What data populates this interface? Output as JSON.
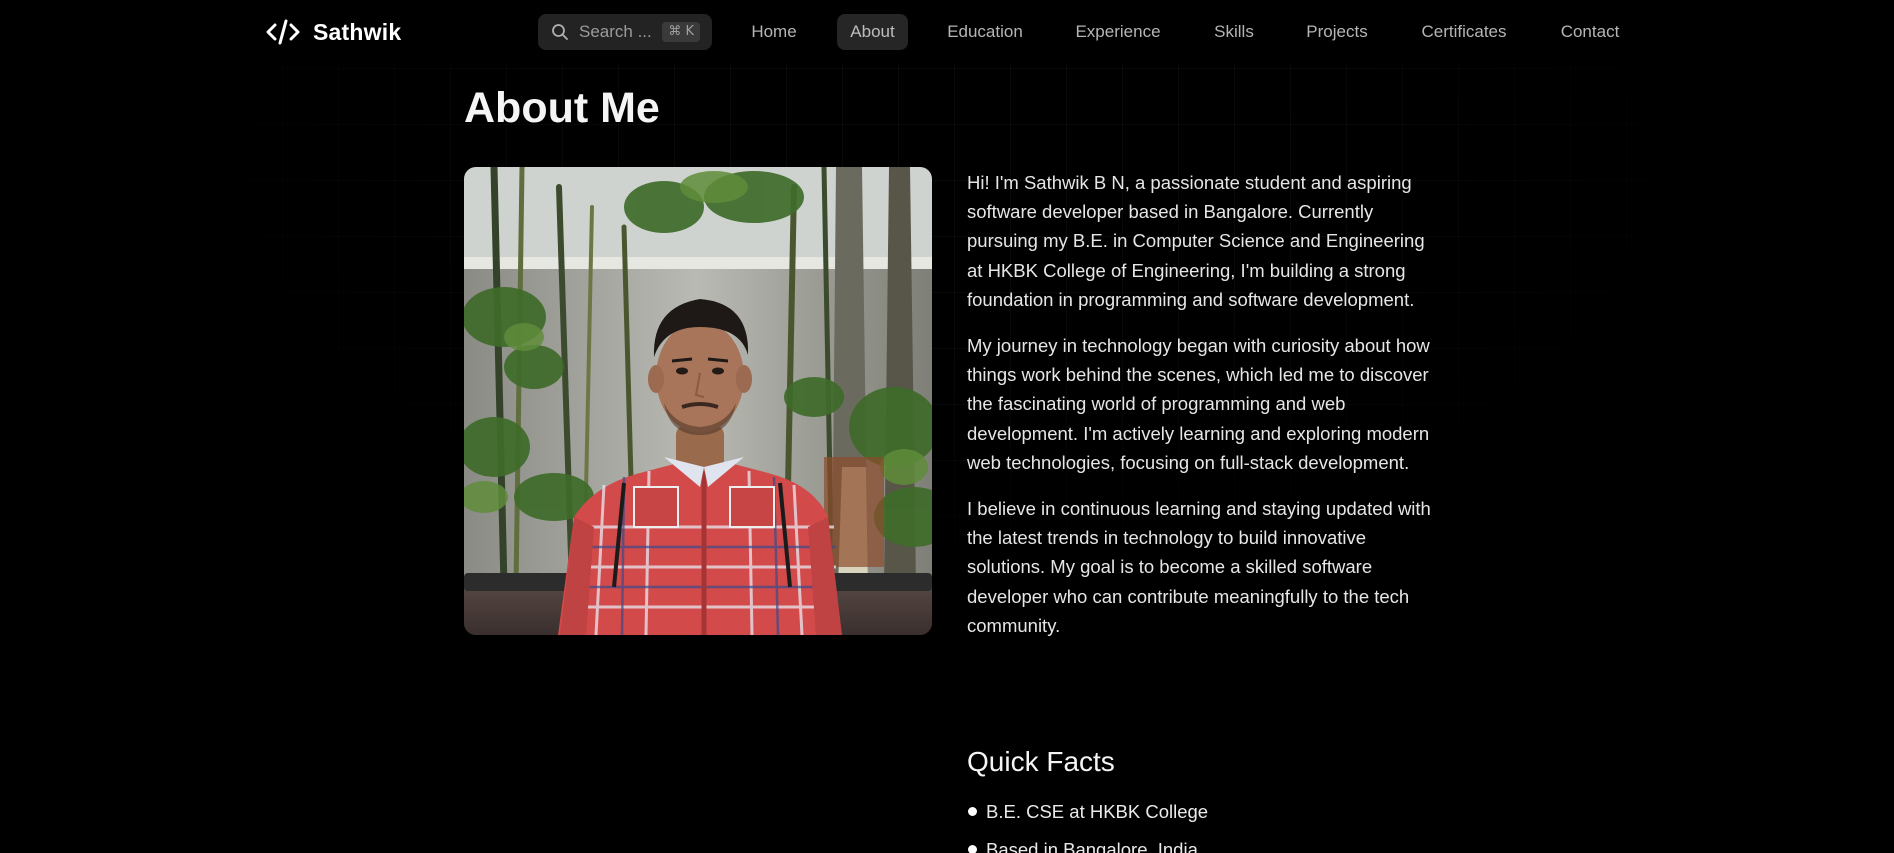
{
  "navbar": {
    "brand": {
      "name": "Sathwik",
      "icon": "code-icon"
    },
    "search": {
      "label": "Search ...",
      "shortcut": "⌘ K",
      "icon": "search-icon"
    },
    "items": [
      {
        "label": "Home",
        "active": false
      },
      {
        "label": "About",
        "active": true
      },
      {
        "label": "Education",
        "active": false
      },
      {
        "label": "Experience",
        "active": false
      },
      {
        "label": "Skills",
        "active": false
      },
      {
        "label": "Projects",
        "active": false
      },
      {
        "label": "Certificates",
        "active": false
      },
      {
        "label": "Contact",
        "active": false
      }
    ]
  },
  "about": {
    "title": "About Me",
    "paragraphs": [
      "Hi! I'm Sathwik B N, a passionate student and aspiring software developer based in Bangalore. Currently pursuing my B.E. in Computer Science and Engineering at HKBK College of Engineering, I'm building a strong foundation in programming and software development.",
      "My journey in technology began with curiosity about how things work behind the scenes, which led me to discover the fascinating world of programming and web development. I'm actively learning and exploring modern web technologies, focusing on full-stack development.",
      "I believe in continuous learning and staying updated with the latest trends in technology to build innovative solutions. My goal is to become a skilled software developer who can contribute meaningfully to the tech community."
    ],
    "quick_facts": {
      "title": "Quick Facts",
      "items": [
        "B.E. CSE at HKBK College",
        "Based in Bangalore, India"
      ]
    }
  },
  "colors": {
    "background": "#000000",
    "nav_active_bg": "#262626",
    "search_bg": "#232323",
    "text_primary": "#f5f5f5",
    "text_muted": "#b5b5b5"
  }
}
